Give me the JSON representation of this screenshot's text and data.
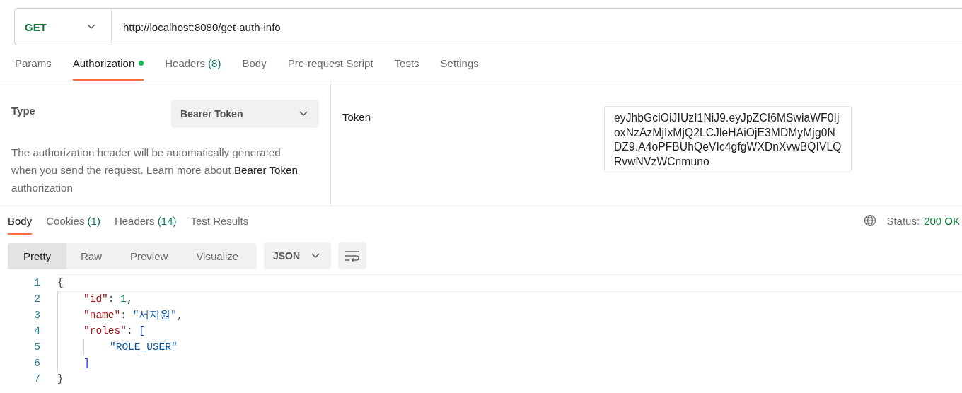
{
  "request": {
    "method": "GET",
    "url": "http://localhost:8080/get-auth-info"
  },
  "request_tabs": [
    {
      "label": "Params",
      "selected": false
    },
    {
      "label": "Authorization",
      "selected": true,
      "indicator": true
    },
    {
      "label": "Headers",
      "count": "(8)",
      "selected": false
    },
    {
      "label": "Body",
      "selected": false
    },
    {
      "label": "Pre-request Script",
      "selected": false
    },
    {
      "label": "Tests",
      "selected": false
    },
    {
      "label": "Settings",
      "selected": false
    }
  ],
  "auth": {
    "type_label": "Type",
    "type_value": "Bearer Token",
    "help_before": "The authorization header will be automatically generated when you send the request. Learn more about ",
    "help_link": "Bearer Token",
    "help_after": " authorization",
    "token_label": "Token",
    "token_value": "eyJhbGciOiJIUzI1NiJ9.eyJpZCI6MSwiaWF0IjoxNzAzMjIxMjQ2LCJleHAiOjE3MDMyMjg0NDZ9.A4oPFBUhQeVIc4gfgWXDnXvwBQIVLQRvwNVzWCnmuno"
  },
  "response_tabs": [
    {
      "label": "Body",
      "selected": true
    },
    {
      "label": "Cookies",
      "count": "(1)",
      "selected": false
    },
    {
      "label": "Headers",
      "count": "(14)",
      "selected": false
    },
    {
      "label": "Test Results",
      "selected": false
    }
  ],
  "status": {
    "label": "Status:",
    "value": "200 OK"
  },
  "view_modes": [
    {
      "label": "Pretty",
      "selected": true
    },
    {
      "label": "Raw",
      "selected": false
    },
    {
      "label": "Preview",
      "selected": false
    },
    {
      "label": "Visualize",
      "selected": false
    }
  ],
  "format": "JSON",
  "code_lines": [
    {
      "number": "1",
      "tokens": [
        {
          "kind": "punct",
          "text": "{"
        }
      ],
      "children": [
        {
          "number": "2",
          "tokens": [
            {
              "kind": "key",
              "text": "\"id\""
            },
            {
              "kind": "punct",
              "text": ": "
            },
            {
              "kind": "number",
              "text": "1"
            },
            {
              "kind": "punct",
              "text": ","
            }
          ]
        },
        {
          "number": "3",
          "tokens": [
            {
              "kind": "key",
              "text": "\"name\""
            },
            {
              "kind": "punct",
              "text": ": "
            },
            {
              "kind": "string",
              "text": "\"서지원\""
            },
            {
              "kind": "punct",
              "text": ","
            }
          ]
        },
        {
          "number": "4",
          "tokens": [
            {
              "kind": "key",
              "text": "\"roles\""
            },
            {
              "kind": "punct",
              "text": ": "
            },
            {
              "kind": "bracket",
              "text": "["
            }
          ],
          "children": [
            {
              "number": "5",
              "tokens": [
                {
                  "kind": "string",
                  "text": "\"ROLE_USER\""
                }
              ]
            }
          ]
        },
        {
          "number": "6",
          "tokens": [
            {
              "kind": "bracket",
              "text": "]"
            }
          ]
        }
      ]
    },
    {
      "number": "7",
      "tokens": [
        {
          "kind": "punct",
          "text": "}"
        }
      ]
    }
  ]
}
